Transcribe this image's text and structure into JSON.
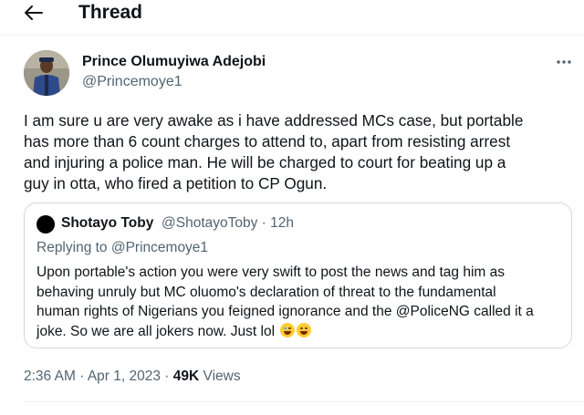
{
  "header": {
    "title": "Thread",
    "back_icon": "arrow-left-icon"
  },
  "tweet": {
    "author_name": "Prince Olumuyiwa Adejobi",
    "author_handle": "@Princemoye1",
    "more_icon": "more-horizontal-icon",
    "text_lines": [
      "I am sure u are very awake as i have addressed MCs  case, but portable",
      "has more than 6 count charges to attend to, apart from resisting arrest",
      "and injuring a police man. He will be charged to court for beating up a",
      "guy in otta, who fired a petition to CP Ogun."
    ],
    "time": "2:36 AM",
    "date": "Apr 1, 2023",
    "separator": "·",
    "views_count": "49K",
    "views_label": "Views"
  },
  "quote": {
    "author_name": "Shotayo Toby",
    "author_handle": "@ShotayoToby",
    "separator": "·",
    "time": "12h",
    "replying_prefix": "Replying to",
    "replying_handle": "@Princemoye1",
    "text_lines": [
      "Upon portable's action you were very swift to post the news and tag him as",
      "behaving unruly but MC oluomo's declaration of threat to the fundamental",
      "human rights of Nigerians you feigned ignorance and the @PoliceNG called it a",
      "joke. So we are all jokers now. Just lol"
    ],
    "emojis": [
      "face-with-tears-of-joy-emoji",
      "grinning-squinting-face-emoji"
    ]
  },
  "colors": {
    "text_primary": "#0f1419",
    "text_secondary": "#536471",
    "border": "#cfd9de"
  }
}
